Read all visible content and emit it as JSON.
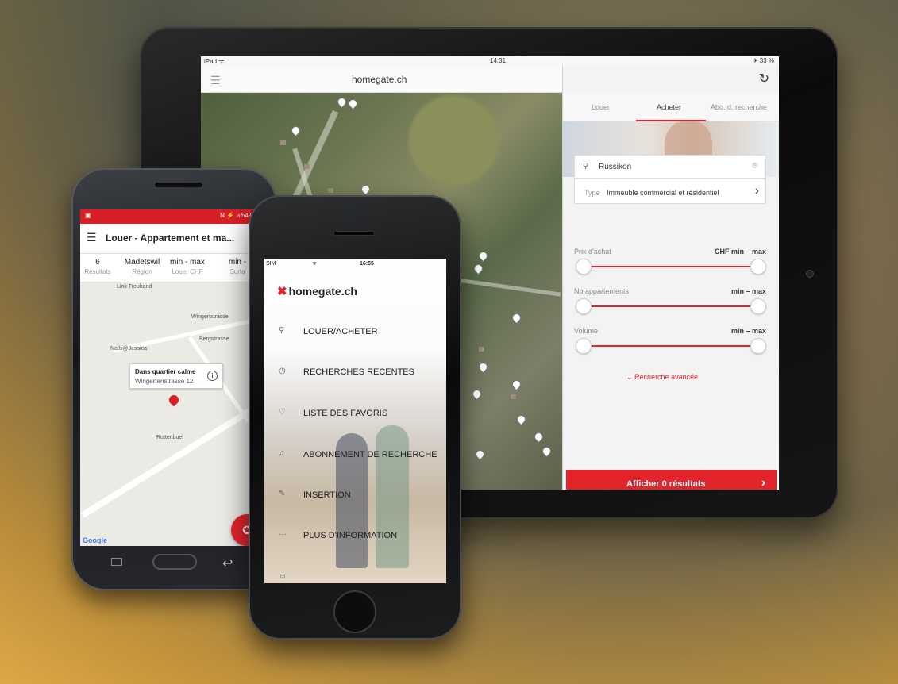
{
  "tablet": {
    "status": {
      "device": "iPad ᯤ",
      "time": "14:31",
      "battery": "✈ 33 %"
    },
    "title": "homegate.ch",
    "tabs": [
      "Louer",
      "Acheter",
      "Abo. d. recherche"
    ],
    "active_tab": "Acheter",
    "search": {
      "value": "Russikon"
    },
    "type": {
      "label": "Type",
      "value": "Immeuble commercial et résidentiel"
    },
    "ranges": [
      {
        "label": "Prix d'achat",
        "value": "CHF min – max"
      },
      {
        "label": "Nb appartements",
        "value": "min – max"
      },
      {
        "label": "Volume",
        "value": "min – max"
      }
    ],
    "advanced_search": "Recherche avancée",
    "cta": "Afficher 0 résultats"
  },
  "android": {
    "status": {
      "left": "▣",
      "right": "N ⚡ ⩘ 54% ▮ 1"
    },
    "title": "Louer - Appartement et ma...",
    "stats": [
      {
        "value": "6",
        "label": "Résultats"
      },
      {
        "value": "Madetswil",
        "label": "Région"
      },
      {
        "value": "min - max",
        "label": "Louer CHF"
      },
      {
        "value": "min -",
        "label": "Surfa"
      }
    ],
    "map_labels": [
      "Link Treuhand",
      "Wingertstrasse",
      "Nails@Jessica",
      "Bergstrasse",
      "Ruttenbuel"
    ],
    "tooltip": {
      "title": "Dans quartier calme",
      "address": "Wingertenstrasse 12"
    },
    "google": "Google"
  },
  "iphone": {
    "status": {
      "carrier": "SIM",
      "wifi": "ᯤ",
      "time": "16:55"
    },
    "logo": "homegate.ch",
    "menu": [
      {
        "icon": "search-icon",
        "label": "LOUER/ACHETER"
      },
      {
        "icon": "clock-icon",
        "label": "RECHERCHES RECENTES"
      },
      {
        "icon": "heart-icon",
        "label": "LISTE DES FAVORIS"
      },
      {
        "icon": "bell-icon",
        "label": "ABONNEMENT DE RECHERCHE"
      },
      {
        "icon": "pencil-icon",
        "label": "INSERTION"
      },
      {
        "icon": "more-icon",
        "label": "PLUS D'INFORMATION"
      }
    ]
  },
  "colors": {
    "brand_red": "#e3242b",
    "android_red": "#d81f26"
  }
}
